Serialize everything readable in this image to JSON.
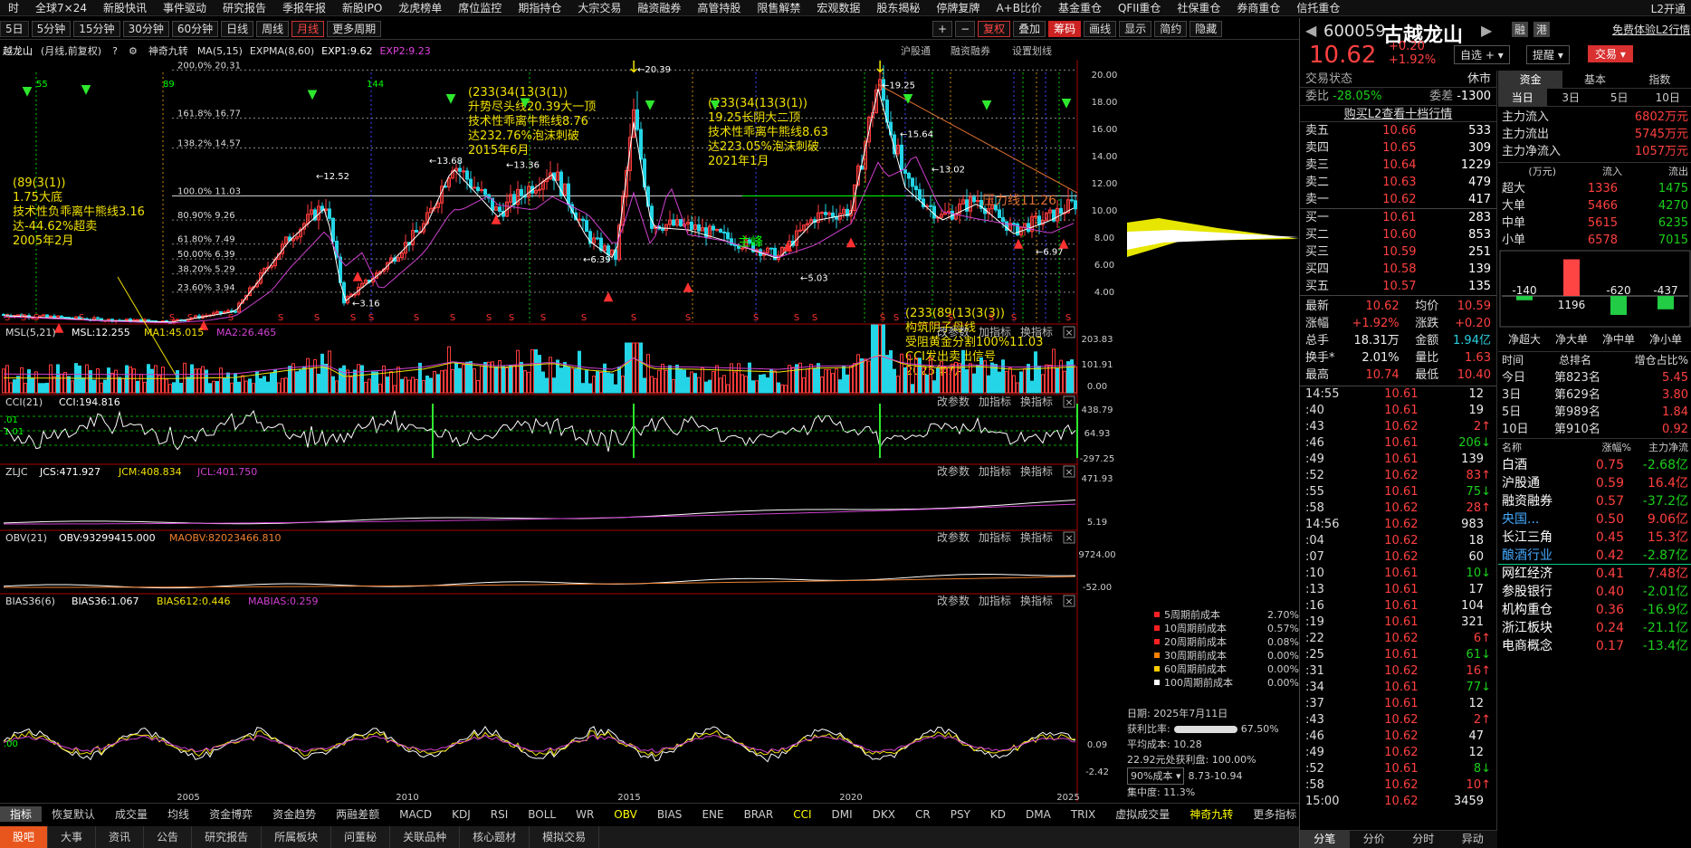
{
  "top_menu": [
    "时",
    "全球7×24",
    "新股快讯",
    "事件驱动",
    "研究报告",
    "季报年报",
    "新股IPO",
    "龙虎榜单",
    "席位监控",
    "期指持仓",
    "大宗交易",
    "融资融券",
    "高管持股",
    "限售解禁",
    "宏观数据",
    "股东揭秘",
    "停牌复牌",
    "A+B比价",
    "基金重仓",
    "QFII重仓",
    "社保重仓",
    "券商重仓",
    "信托重仓"
  ],
  "top_right": "L2开通",
  "period_btns": [
    "5日",
    "5分钟",
    "15分钟",
    "30分钟",
    "60分钟",
    "日线",
    "周线",
    "月线",
    "更多周期"
  ],
  "period_active": "月线",
  "right_tools": [
    "复权",
    "叠加",
    "筹码",
    "画线",
    "显示",
    "简约",
    "隐藏"
  ],
  "chart_header": {
    "name": "越龙山",
    "mode": "(月线,前复权)",
    "indicator": "神奇九转",
    "ma": "MA(5,15)",
    "expma": "EXPMA(8,60)",
    "exp1": "EXP1:9.62",
    "exp2": "EXP2:9.23",
    "links": [
      "沪股通",
      "融资融券",
      "设置划线"
    ]
  },
  "annotations": {
    "a1": [
      "(89(3(1))",
      "1.75大底",
      "技术性负乖离牛熊线3.16",
      "达-44.62%超卖",
      "2005年2月"
    ],
    "a2": [
      "(233(34(13(3(1))",
      "升势尽头线20.39大一顶",
      "技术性乖离牛熊线8.76",
      "达232.76%泡沫刺破",
      "2015年6月"
    ],
    "a3": [
      "(233(34(13(3(1))",
      "19.25长阴大二顶",
      "技术性乖离牛熊线8.63",
      "达223.05%泡沫刺破",
      "2021年1月"
    ],
    "a4": [
      "(233(89(13(3(3))",
      "构筑阴子母线",
      "受阻黄金分割100%11.03",
      "CCI发出卖出信号",
      "2025年7月"
    ],
    "pressure": "压力线11.26",
    "main_peak": "主峰",
    "fib": [
      "200.0% 20.31",
      "161.8% 16.77",
      "138.2% 14.57",
      "100.0% 11.03",
      "80.90% 9.26",
      "61.80% 7.49",
      "50.00% 6.39",
      "38.20% 5.29",
      "23.60% 3.94"
    ]
  },
  "price_axis": [
    "20.00",
    "18.00",
    "16.00",
    "14.00",
    "12.00",
    "10.00",
    "8.00",
    "6.00",
    "4.00"
  ],
  "years": [
    "2005",
    "2010",
    "2015",
    "2020",
    "2025"
  ],
  "panes": {
    "msl": {
      "label": "MSL(5,21)",
      "v1": "MSL:12.255",
      "v2": "MA1:45.015",
      "v3": "MA2:26.465",
      "axis": [
        "203.83",
        "101.91",
        "0.00"
      ]
    },
    "cci": {
      "label": "CCI(21)",
      "v1": "CCI:194.816",
      "axis": [
        "438.79",
        "64.93",
        "-297.25"
      ],
      "left": [
        ".01",
        "1.01"
      ]
    },
    "zljc": {
      "label": "ZLJC",
      "v1": "JCS:471.927",
      "v2": "JCM:408.834",
      "v3": "JCL:401.750",
      "axis": [
        "471.93",
        "5.19"
      ]
    },
    "obv": {
      "label": "OBV(21)",
      "v1": "OBV:93299415.000",
      "v2": "MAOBV:82023466.810",
      "axis": [
        "9724.00",
        "-52.00"
      ]
    },
    "bias": {
      "label": "BIAS36(6)",
      "v1": "BIAS36:1.067",
      "v2": "BIAS612:0.446",
      "v3": "MABIAS:0.259",
      "axis": [
        "0.09",
        "-2.42"
      ],
      "left": ".00"
    }
  },
  "pane_actions": [
    "改参数",
    "加指标",
    "换指标"
  ],
  "cost": {
    "rows": [
      [
        "5周期前成本",
        "2.70%"
      ],
      [
        "10周期前成本",
        "0.57%"
      ],
      [
        "20周期前成本",
        "0.08%"
      ],
      [
        "30周期前成本",
        "0.00%"
      ],
      [
        "60周期前成本",
        "0.00%"
      ],
      [
        "100周期前成本",
        "0.00%"
      ]
    ],
    "date": "日期: 2025年7月11日",
    "profit": "获利比率:",
    "profit_v": "67.50%",
    "avg": "平均成本: 10.28",
    "p22": "22.92元处获利盘: 100.00%",
    "sel": "90%成本",
    "range": "8.73-10.94",
    "conc": "集中度: 11.3%"
  },
  "bottom_indicators": [
    "指标",
    "恢复默认",
    "成交量",
    "均线",
    "资金博弈",
    "资金趋势",
    "两融差额",
    "MACD",
    "KDJ",
    "RSI",
    "BOLL",
    "WR",
    "OBV",
    "BIAS",
    "ENE",
    "BRAR",
    "CCI",
    "DMI",
    "DKX",
    "CR",
    "PSY",
    "KD",
    "DMA",
    "TRIX",
    "虚拟成交量",
    "神奇九转",
    "更多指标",
    "模板"
  ],
  "bottom_tabs": [
    "股吧",
    "大事",
    "资讯",
    "公告",
    "研究报告",
    "所属板块",
    "问董秘",
    "关联品种",
    "核心题材",
    "模拟交易"
  ],
  "stock": {
    "code": "600059",
    "name": "古越龙山",
    "price": "10.62",
    "chg": "+0.20",
    "pct": "+1.92%",
    "self": "自选",
    "remind": "提醒",
    "trade": "交易",
    "rong": "融",
    "gang": "港",
    "freel2": "免费体验L2行情"
  },
  "status": {
    "label": "交易状态",
    "val": "休市",
    "wb_l": "委比",
    "wb_v": "-28.05%",
    "wc_l": "委差",
    "wc_v": "-1300",
    "buyl2": "购买L2查看十档行情"
  },
  "asks": [
    [
      "卖五",
      "10.66",
      "533"
    ],
    [
      "卖四",
      "10.65",
      "309"
    ],
    [
      "卖三",
      "10.64",
      "1229"
    ],
    [
      "卖二",
      "10.63",
      "479"
    ],
    [
      "卖一",
      "10.62",
      "417"
    ]
  ],
  "bids": [
    [
      "买一",
      "10.61",
      "283"
    ],
    [
      "买二",
      "10.60",
      "853"
    ],
    [
      "买三",
      "10.59",
      "251"
    ],
    [
      "买四",
      "10.58",
      "139"
    ],
    [
      "买五",
      "10.57",
      "135"
    ]
  ],
  "stats": [
    [
      "最新",
      "10.62",
      "均价",
      "10.59"
    ],
    [
      "涨幅",
      "+1.92%",
      "涨跌",
      "+0.20"
    ],
    [
      "总手",
      "18.31万",
      "金额",
      "1.94亿"
    ],
    [
      "换手*",
      "2.01%",
      "量比",
      "1.63"
    ],
    [
      "最高",
      "10.74",
      "最低",
      "10.40"
    ]
  ],
  "ticks": [
    [
      "14:55",
      "10.61",
      "12",
      ""
    ],
    [
      ":40",
      "10.61",
      "19",
      ""
    ],
    [
      ":43",
      "10.62",
      "2",
      "up"
    ],
    [
      ":46",
      "10.61",
      "206",
      "dn"
    ],
    [
      ":49",
      "10.61",
      "139",
      ""
    ],
    [
      ":52",
      "10.62",
      "83",
      "up"
    ],
    [
      ":55",
      "10.61",
      "75",
      "dn"
    ],
    [
      ":58",
      "10.62",
      "28",
      "up"
    ],
    [
      "14:56",
      "10.62",
      "983",
      ""
    ],
    [
      ":04",
      "10.62",
      "18",
      ""
    ],
    [
      ":07",
      "10.62",
      "60",
      ""
    ],
    [
      ":10",
      "10.61",
      "10",
      "dn"
    ],
    [
      ":13",
      "10.61",
      "17",
      ""
    ],
    [
      ":16",
      "10.61",
      "104",
      ""
    ],
    [
      ":19",
      "10.61",
      "321",
      ""
    ],
    [
      ":22",
      "10.62",
      "6",
      "up"
    ],
    [
      ":25",
      "10.61",
      "61",
      "dn"
    ],
    [
      ":31",
      "10.62",
      "16",
      "up"
    ],
    [
      ":34",
      "10.61",
      "77",
      "dn"
    ],
    [
      ":37",
      "10.61",
      "12",
      ""
    ],
    [
      ":43",
      "10.62",
      "2",
      "up"
    ],
    [
      ":46",
      "10.62",
      "47",
      ""
    ],
    [
      ":49",
      "10.62",
      "12",
      ""
    ],
    [
      ":52",
      "10.61",
      "8",
      "dn"
    ],
    [
      ":58",
      "10.62",
      "10",
      "up"
    ],
    [
      "15:00",
      "10.62",
      "3459",
      ""
    ]
  ],
  "tick_tabs": [
    "分笔",
    "分价",
    "分时",
    "异动"
  ],
  "fund_tabs": [
    "资金",
    "基本",
    "指数"
  ],
  "day_tabs": [
    "当日",
    "3日",
    "5日",
    "10日"
  ],
  "flows": [
    [
      "主力流入",
      "6802万元"
    ],
    [
      "主力流出",
      "5745万元"
    ],
    [
      "主力净流入",
      "1057万元"
    ]
  ],
  "flow_hdr": [
    "(万元)",
    "流入",
    "流出"
  ],
  "flow_rows": [
    [
      "超大",
      "1336",
      "1475"
    ],
    [
      "大单",
      "5466",
      "4270"
    ],
    [
      "中单",
      "5615",
      "6235"
    ],
    [
      "小单",
      "6578",
      "7015"
    ]
  ],
  "bar_vals": [
    "-140",
    "1196",
    "-620",
    "-437"
  ],
  "bar_labels": [
    "净超大",
    "净大单",
    "净中单",
    "净小单"
  ],
  "rank_hdr": [
    "时间",
    "总排名",
    "增仓占比%"
  ],
  "ranks": [
    [
      "今日",
      "第823名",
      "5.45"
    ],
    [
      "3日",
      "第629名",
      "3.80"
    ],
    [
      "5日",
      "第989名",
      "1.84"
    ],
    [
      "10日",
      "第910名",
      "0.92"
    ]
  ],
  "sector_hdr": [
    "名称",
    "涨幅%",
    "主力净流"
  ],
  "sectors": [
    [
      "白酒",
      "0.75",
      "-2.68亿"
    ],
    [
      "沪股通",
      "0.59",
      "16.4亿"
    ],
    [
      "融资融券",
      "0.57",
      "-37.2亿"
    ],
    [
      "央国...",
      "0.50",
      "9.06亿"
    ],
    [
      "长江三角",
      "0.45",
      "15.3亿"
    ],
    [
      "酿酒行业",
      "0.42",
      "-2.87亿"
    ],
    [
      "网红经济",
      "0.41",
      "7.48亿"
    ],
    [
      "参股银行",
      "0.40",
      "-2.01亿"
    ],
    [
      "机构重仓",
      "0.36",
      "-16.9亿"
    ],
    [
      "浙江板块",
      "0.24",
      "-21.1亿"
    ],
    [
      "电商概念",
      "0.17",
      "-13.4亿"
    ]
  ]
}
